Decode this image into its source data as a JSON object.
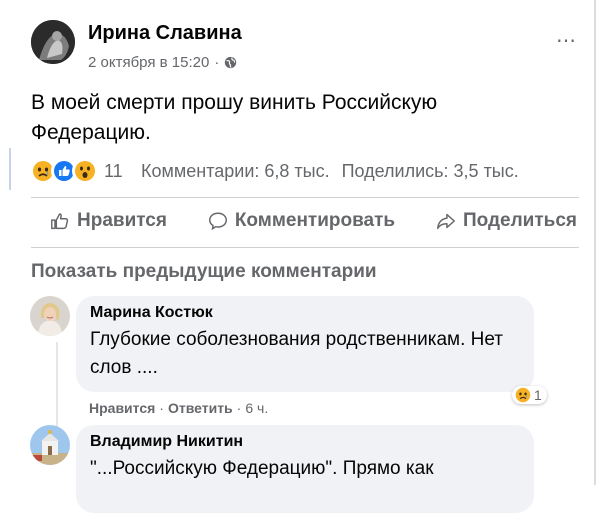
{
  "post": {
    "author": "Ирина Славина",
    "timestamp": "2 октября в 15:20",
    "separator": "·",
    "more_icon": "⋯",
    "text": "В моей смерти прошу винить Российскую Федерацию.",
    "reaction_icons": [
      "sad-icon",
      "like-icon",
      "wow-icon"
    ],
    "reaction_count": "11",
    "comments_stat": "Комментарии: 6,8 тыс.",
    "shares_stat": "Поделились: 3,5 тыс."
  },
  "actions": {
    "like": "Нравится",
    "comment": "Комментировать",
    "share": "Поделиться"
  },
  "show_previous": "Показать предыдущие комментарии",
  "comments": [
    {
      "name": "Марина Костюк",
      "text": "Глубокие соболезнования родственникам. Нет слов ....",
      "like": "Нравится",
      "sep": "·",
      "reply": "Ответить",
      "time": "6 ч.",
      "reaction_count": "1"
    },
    {
      "name": "Владимир Никитин",
      "text": "\"...Российскую Федерацию\". Прямо как"
    }
  ],
  "colors": {
    "secondary_text": "#65676b",
    "bubble": "#f0f2f5",
    "like_blue": "#1877f2",
    "emoji_yellow": "#f7b125"
  }
}
